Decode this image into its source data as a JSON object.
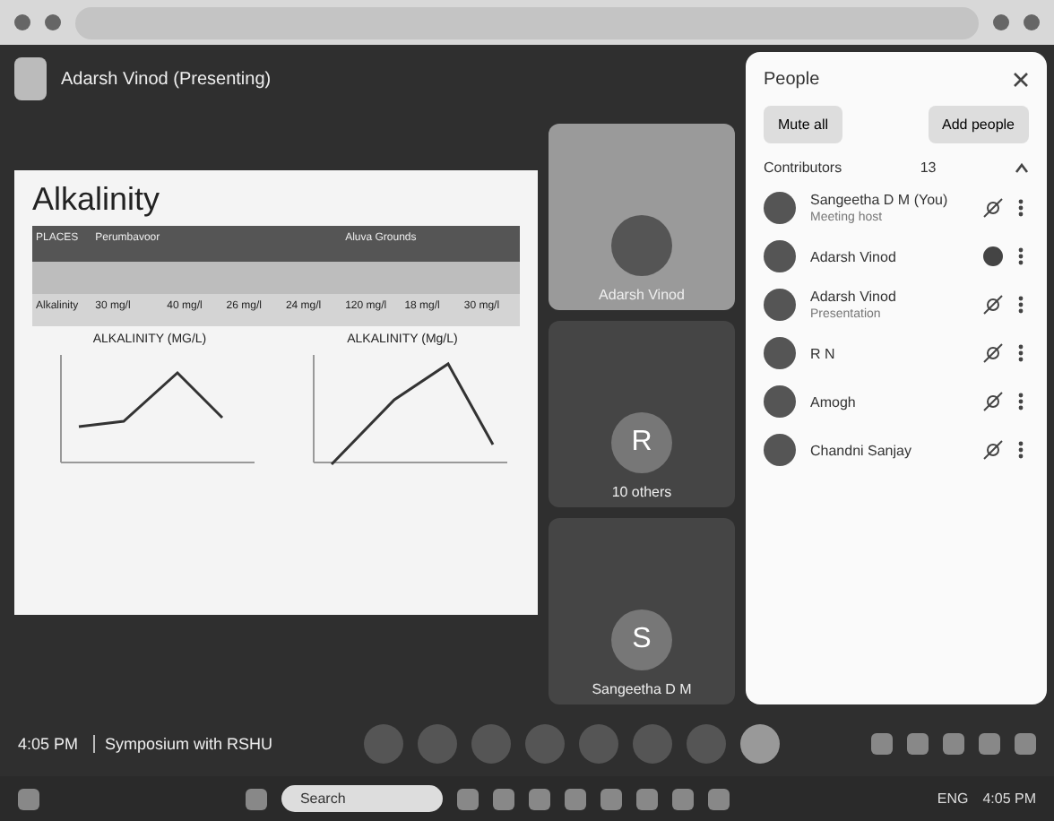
{
  "meeting_header": {
    "presenter": "Adarsh Vinod (Presenting)"
  },
  "slide": {
    "title": "Alkalinity",
    "table": {
      "header": [
        "PLACES",
        "Perumbavoor",
        "Aluva Grounds"
      ],
      "rows": [
        [
          "Alkalinity",
          "30 mg/l",
          "40 mg/l",
          "26 mg/l",
          "24 mg/l",
          "120 mg/l",
          "18 mg/l",
          "30 mg/l"
        ]
      ]
    },
    "chart_titles": [
      "ALKALINITY (MG/L)",
      "ALKALINITY (Mg/L)"
    ]
  },
  "tiles": [
    {
      "kind": "video",
      "name": "Adarsh Vinod"
    },
    {
      "kind": "group",
      "letter": "R",
      "name": "10 others"
    },
    {
      "kind": "avatar",
      "letter": "S",
      "name": "Sangeetha D M"
    }
  ],
  "people": {
    "title": "People",
    "buttons": [
      "Mute all",
      "Add people"
    ],
    "section": "Contributors",
    "count": "13",
    "expanded": true,
    "members": [
      {
        "name": "Sangeetha D M (You)",
        "role": "Meeting host",
        "muted": true
      },
      {
        "name": "Adarsh Vinod",
        "muted": false
      },
      {
        "name": "Adarsh Vinod",
        "role": "Presentation",
        "muted": true
      },
      {
        "name": "R N",
        "muted": true
      },
      {
        "name": "Amogh",
        "muted": true
      },
      {
        "name": "Chandni Sanjay",
        "muted": true
      }
    ]
  },
  "footer": {
    "time": "4:05 PM",
    "meeting": "Symposium with RSHU"
  },
  "taskbar": {
    "search": "Search",
    "lang": "ENG",
    "time": "4:05 PM"
  }
}
